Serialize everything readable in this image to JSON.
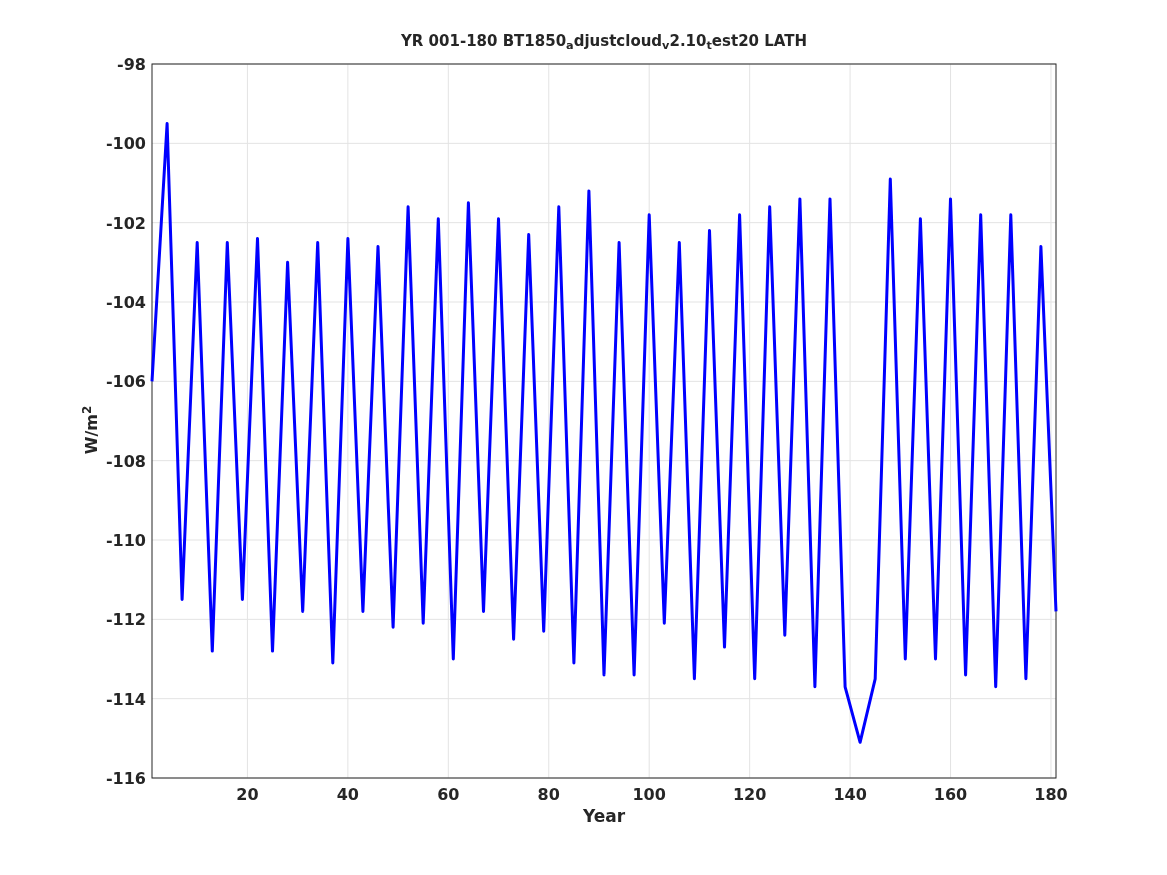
{
  "figure": {
    "chart_data": {
      "type": "line",
      "grid": true,
      "title": "YR 001-180 BT1850$_{a}$djustcloud$_{v}$2.10$_{t}$est20 LATH",
      "xlabel": "Year",
      "ylabel": "W/m$^{2}$",
      "xlim": [
        1,
        181
      ],
      "ylim": [
        -116,
        -98
      ],
      "xticks": [
        20,
        40,
        60,
        80,
        100,
        120,
        140,
        160,
        180
      ],
      "yticks": [
        -98,
        -100,
        -102,
        -104,
        -106,
        -108,
        -110,
        -112,
        -114,
        -116
      ],
      "x": [
        1,
        4,
        7,
        10,
        13,
        16,
        19,
        22,
        25,
        28,
        31,
        34,
        37,
        40,
        43,
        46,
        49,
        52,
        55,
        58,
        61,
        64,
        67,
        70,
        73,
        76,
        79,
        82,
        85,
        88,
        91,
        94,
        97,
        100,
        103,
        106,
        109,
        112,
        115,
        118,
        121,
        124,
        127,
        130,
        133,
        136,
        139,
        142,
        145,
        148,
        151,
        154,
        157,
        160,
        163,
        166,
        169,
        172,
        175,
        178,
        181
      ],
      "series": [
        {
          "color": "#0000ff",
          "values": [
            -106,
            -99.5,
            -111.5,
            -102.5,
            -112.8,
            -102.5,
            -111.5,
            -102.4,
            -112.8,
            -103,
            -111.8,
            -102.5,
            -113.1,
            -102.4,
            -111.8,
            -102.6,
            -112.2,
            -101.6,
            -112.1,
            -101.9,
            -113,
            -101.5,
            -111.8,
            -101.9,
            -112.5,
            -102.3,
            -112.3,
            -101.6,
            -113.1,
            -101.2,
            -113.4,
            -102.5,
            -113.4,
            -101.8,
            -112.1,
            -102.5,
            -113.5,
            -102.2,
            -112.7,
            -101.8,
            -113.5,
            -101.6,
            -112.4,
            -101.4,
            -113.7,
            -101.4,
            -113.7,
            -115.1,
            -113.5,
            -100.9,
            -113,
            -101.9,
            -113,
            -101.4,
            -113.4,
            -101.8,
            -113.7,
            -101.8,
            -113.5,
            -102.6,
            -111.8
          ]
        }
      ]
    }
  }
}
